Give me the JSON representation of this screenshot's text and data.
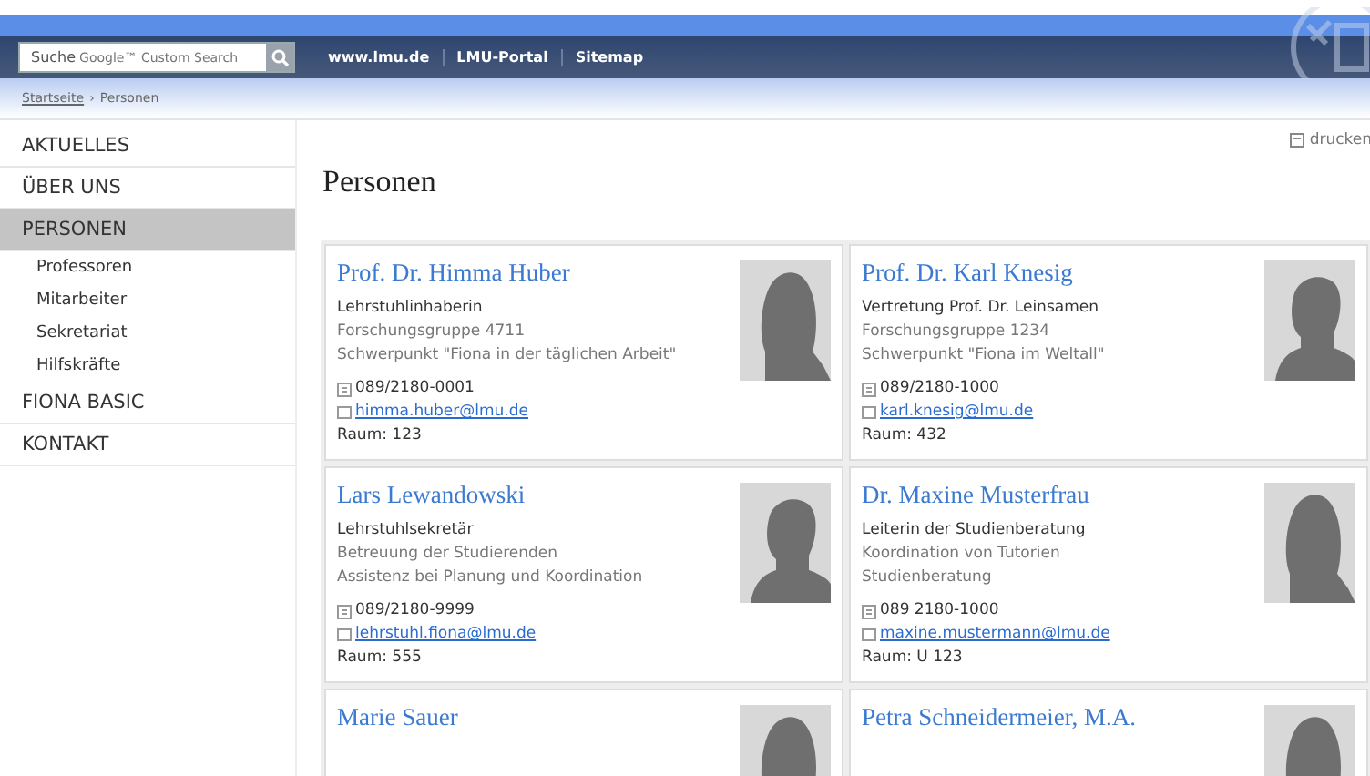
{
  "header": {
    "search": {
      "label": "Suche",
      "placeholder": "Google™ Custom Search"
    },
    "links": [
      "www.lmu.de",
      "LMU-Portal",
      "Sitemap"
    ]
  },
  "breadcrumb": {
    "link": "Startseite",
    "separator": "›",
    "current": "Personen"
  },
  "sidebar": {
    "items": [
      {
        "label": "AKTUELLES",
        "selected": false
      },
      {
        "label": "ÜBER UNS",
        "selected": false
      },
      {
        "label": "PERSONEN",
        "selected": true,
        "children": [
          {
            "label": "Professoren"
          },
          {
            "label": "Mitarbeiter"
          },
          {
            "label": "Sekretariat"
          },
          {
            "label": "Hilfskräfte"
          }
        ]
      },
      {
        "label": "FIONA BASIC",
        "selected": false
      },
      {
        "label": "KONTAKT",
        "selected": false
      }
    ]
  },
  "print_link": "drucken",
  "page_title": "Personen",
  "people": [
    {
      "name": "Prof. Dr. Himma Huber",
      "role": "Lehrstuhlinhaberin",
      "details": [
        "Forschungsgruppe 4711",
        "Schwerpunkt \"Fiona in der täglichen Arbeit\""
      ],
      "phone": "089/2180-0001",
      "email": "himma.huber@lmu.de",
      "room": "Raum: 123",
      "kind": "female"
    },
    {
      "name": "Prof. Dr. Karl Knesig",
      "role": "Vertretung Prof. Dr. Leinsamen",
      "details": [
        "Forschungsgruppe 1234",
        "Schwerpunkt \"Fiona im Weltall\""
      ],
      "phone": "089/2180-1000",
      "email": "karl.knesig@lmu.de",
      "room": "Raum: 432",
      "kind": "male"
    },
    {
      "name": "Lars Lewandowski",
      "role": "Lehrstuhlsekretär",
      "details": [
        "Betreuung der Studierenden",
        "Assistenz bei Planung und Koordination"
      ],
      "phone": "089/2180-9999",
      "email": "lehrstuhl.fiona@lmu.de",
      "room": "Raum: 555",
      "kind": "male"
    },
    {
      "name": "Dr. Maxine Musterfrau",
      "role": "Leiterin der Studienberatung",
      "details": [
        "Koordination von Tutorien",
        "Studienberatung"
      ],
      "phone": "089 2180-1000",
      "email": "maxine.mustermann@lmu.de",
      "room": "Raum: U 123",
      "kind": "female"
    },
    {
      "name": "Marie Sauer",
      "kind": "female"
    },
    {
      "name": "Petra Schneidermeier, M.A.",
      "kind": "female"
    }
  ]
}
